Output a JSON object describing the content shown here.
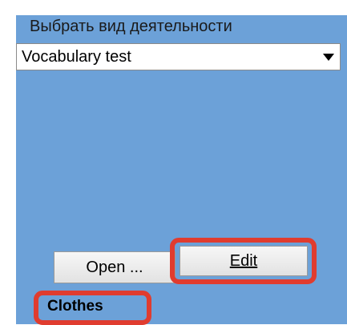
{
  "activity_panel": {
    "label": "Выбрать вид деятельности",
    "selected_activity": "Vocabulary test",
    "dropdown_icon": "triangle-down-icon"
  },
  "buttons": {
    "open_label": "Open ...",
    "edit_label": "Edit"
  },
  "topic": {
    "name": "Clothes"
  },
  "colors": {
    "panel_background": "#6ca1d8",
    "highlight": "#e03c2f"
  }
}
